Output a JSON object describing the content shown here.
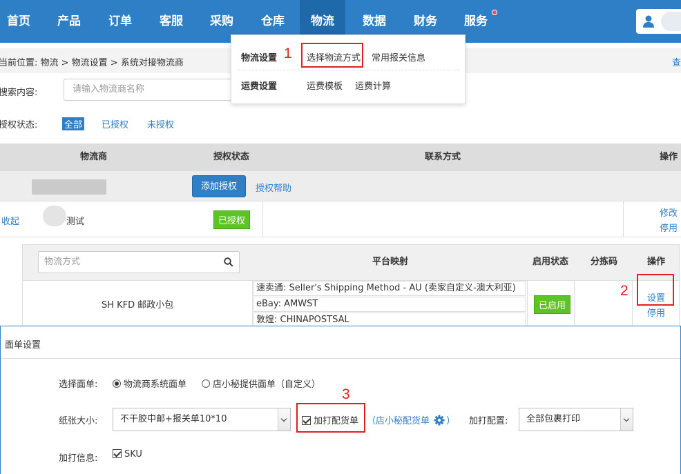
{
  "nav": {
    "items": [
      "首页",
      "产品",
      "订单",
      "客服",
      "采购",
      "仓库",
      "物流",
      "数据",
      "财务",
      "服务"
    ],
    "active": "物流"
  },
  "dropdown": {
    "group1_title": "物流设置",
    "group1_items": [
      "选择物流方式",
      "常用报关信息"
    ],
    "group2_title": "运费设置",
    "group2_items": [
      "运费模板",
      "运费计算"
    ]
  },
  "breadcrumb": {
    "text": "当前位置:  物流 > 物流设置 > 系统对接物流商",
    "right": "查"
  },
  "search": {
    "label": "搜索内容:",
    "placeholder": "请输入物流商名称"
  },
  "auth_filter": {
    "label": "授权状态:",
    "options": [
      "全部",
      "已授权",
      "未授权"
    ]
  },
  "table": {
    "headers": [
      "物流商",
      "授权状态",
      "联系方式",
      "操作"
    ],
    "add_auth_button": "添加授权",
    "auth_help_link": "授权帮助",
    "row": {
      "collapse_link": "收起",
      "name": "测试",
      "status": "已授权",
      "actions": [
        "修改",
        "停用"
      ]
    }
  },
  "subtable": {
    "search_placeholder": "物流方式",
    "headers": [
      "平台映射",
      "启用状态",
      "分拣码",
      "操作"
    ],
    "row": {
      "name": "SH KFD 邮政小包",
      "mappings": [
        "速卖通:  Seller's Shipping Method - AU (卖家自定义-澳大利亚)",
        "eBay:  AMWST",
        "敦煌:  CHINAPOSTSAL"
      ],
      "status": "已启用",
      "actions": [
        "设置",
        "停用"
      ]
    }
  },
  "modal": {
    "title": "面单设置",
    "select_label": "选择面单:",
    "radio_options": [
      "物流商系统面单",
      "店小秘提供面单（自定义）"
    ],
    "paper_label": "纸张大小:",
    "paper_value": "不干胶中邮+报关单10*10",
    "print_checkbox": "加打配货单",
    "shop_link": "店小秘配货单",
    "paren_open": "（",
    "paren_close": "）",
    "print_config_label": "加打配置:",
    "print_config_value": "全部包裹打印",
    "print_info_label": "加打信息:",
    "sku_checkbox": "SKU"
  },
  "annotations": [
    "1",
    "2",
    "3"
  ],
  "colors": {
    "primary": "#2e7fc6",
    "success": "#5ec324",
    "annotation": "#e02020"
  }
}
